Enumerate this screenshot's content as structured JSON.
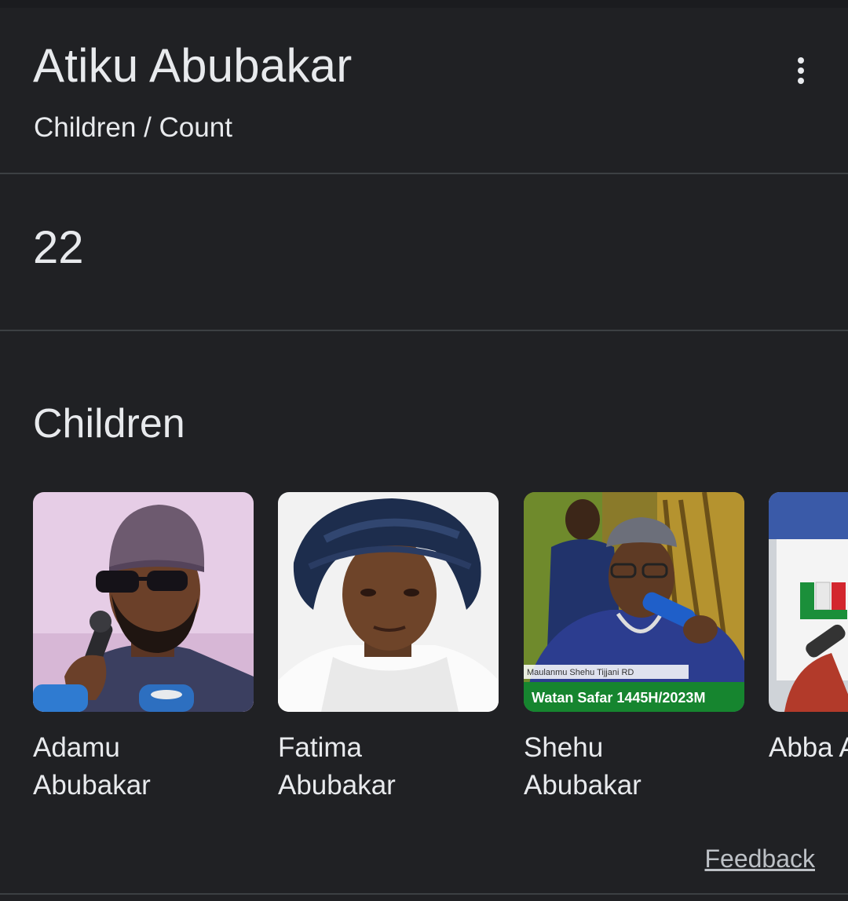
{
  "header": {
    "title": "Atiku Abubakar",
    "breadcrumb": "Children / Count",
    "more_icon": "more-vert-icon"
  },
  "answer": {
    "value": "22"
  },
  "children_section": {
    "title": "Children",
    "items": [
      {
        "label": "Adamu\nAbubakar",
        "image": "photo-adamu-abubakar"
      },
      {
        "label": "Fatima\nAbubakar",
        "image": "photo-fatima-abubakar"
      },
      {
        "label": "Shehu\nAbubakar",
        "image": "photo-shehu-abubakar",
        "caption_small": "Maulanmu Shehu Tijjani RD",
        "caption_banner": "Watan Safar 1445H/2023M"
      },
      {
        "label": "Abba A",
        "image": "photo-abba-abubakar"
      }
    ]
  },
  "footer": {
    "feedback_label": "Feedback"
  },
  "colors": {
    "background": "#202124",
    "text": "#e8eaed",
    "divider": "#3c4043",
    "muted": "#bdc1c6"
  }
}
